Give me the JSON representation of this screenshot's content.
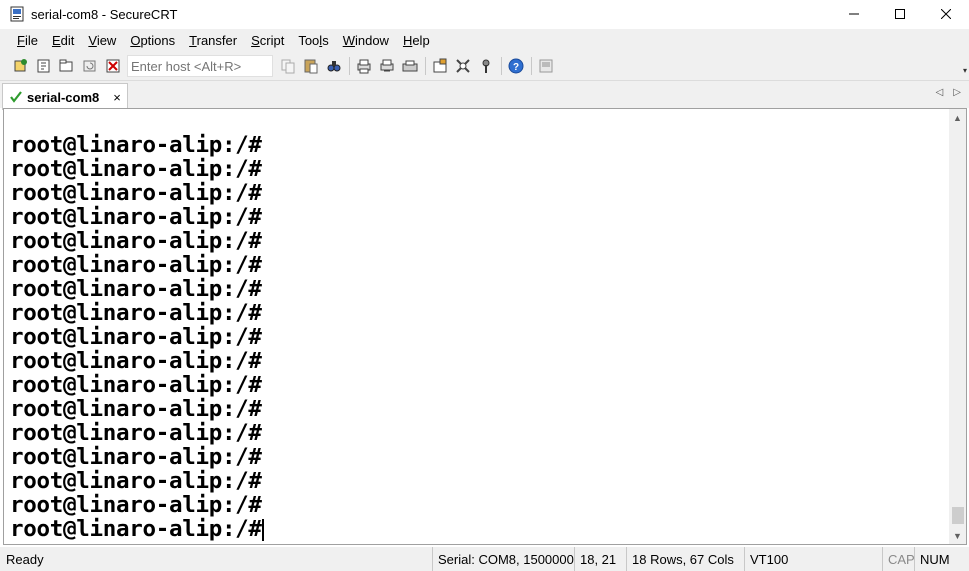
{
  "window": {
    "title": "serial-com8 - SecureCRT",
    "controls": {
      "minimize": "—",
      "maximize": "☐",
      "close": "✕"
    }
  },
  "menu": [
    {
      "key": "F",
      "rest": "ile"
    },
    {
      "key": "E",
      "rest": "dit"
    },
    {
      "key": "V",
      "rest": "iew"
    },
    {
      "key": "O",
      "rest": "ptions"
    },
    {
      "key": "T",
      "rest": "ransfer"
    },
    {
      "key": "S",
      "rest": "cript"
    },
    {
      "key": "Too",
      "rest": "ls",
      "underline_last": "l"
    },
    {
      "key": "W",
      "rest": "indow"
    },
    {
      "key": "H",
      "rest": "elp"
    }
  ],
  "toolbar": {
    "host_placeholder": "Enter host <Alt+R>",
    "overflow": "▾",
    "icons": [
      "connect-icon",
      "quick-connect-icon",
      "connect-tab-icon",
      "reconnect-icon",
      "disconnect-icon",
      "copy-icon",
      "paste-icon",
      "find-icon",
      "print-icon",
      "print-selection-icon",
      "printer-icon",
      "session-options-icon",
      "global-options-icon",
      "keymap-icon",
      "help-icon",
      "sftp-icon"
    ]
  },
  "tabs": [
    {
      "label": "serial-com8",
      "close": "×",
      "status": "connected",
      "status_color": "#2e9b2e"
    }
  ],
  "tab_nav": {
    "prev": "◁",
    "next": "▷"
  },
  "terminal": {
    "lines": [
      "root@linaro-alip:/#",
      "root@linaro-alip:/#",
      "root@linaro-alip:/#",
      "root@linaro-alip:/#",
      "root@linaro-alip:/#",
      "root@linaro-alip:/#",
      "root@linaro-alip:/#",
      "root@linaro-alip:/#",
      "root@linaro-alip:/#",
      "root@linaro-alip:/#",
      "root@linaro-alip:/#",
      "root@linaro-alip:/#",
      "root@linaro-alip:/#",
      "root@linaro-alip:/#",
      "root@linaro-alip:/#",
      "root@linaro-alip:/#",
      "root@linaro-alip:/#"
    ],
    "scroll_up": "▲",
    "scroll_down": "▼"
  },
  "status": {
    "ready": "Ready",
    "connection": "Serial: COM8, 1500000",
    "cursor": "18,  21",
    "size": "18 Rows, 67 Cols",
    "emulation": "VT100",
    "cap": "CAP",
    "num": "NUM"
  }
}
